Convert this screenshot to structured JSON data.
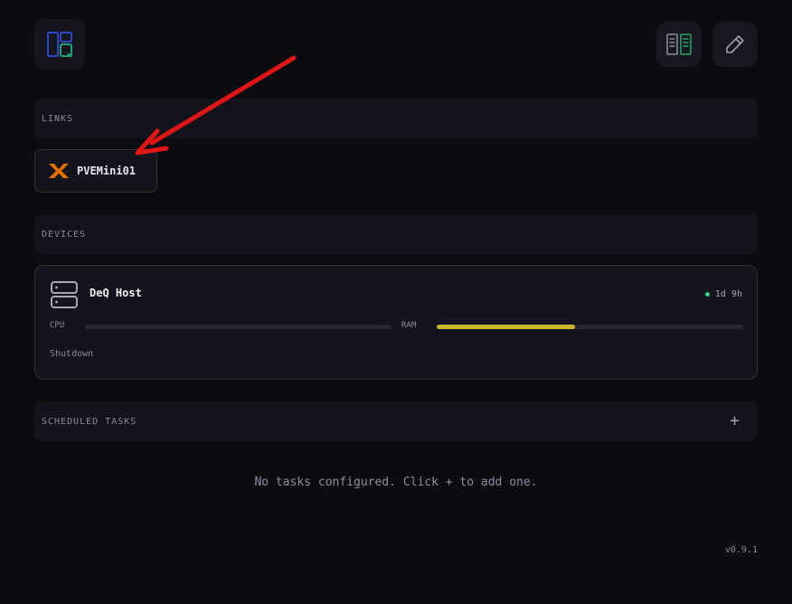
{
  "header": {
    "logo_icon": "deq-logo-icon",
    "layout_button_icon": "panels-icon",
    "edit_button_icon": "pencil-icon"
  },
  "links": {
    "title": "LINKS",
    "items": [
      {
        "label": "PVEMini01",
        "icon": "proxmox-icon",
        "icon_color": "#e57000"
      }
    ]
  },
  "devices": {
    "title": "DEVICES",
    "items": [
      {
        "name": "DeQ Host",
        "icon": "server-icon",
        "uptime": "1d 9h",
        "status_color": "#2fd67a",
        "cpu_label": "CPU",
        "cpu_fraction": 0.0,
        "ram_label": "RAM",
        "ram_fraction": 0.45,
        "ram_color": "#c9b92c",
        "shutdown_label": "Shutdown"
      }
    ]
  },
  "tasks": {
    "title": "SCHEDULED TASKS",
    "add_label": "+",
    "empty_message": "No tasks configured. Click + to add one."
  },
  "version": "v0.9.1",
  "annotation": {
    "type": "arrow",
    "color": "#e01616",
    "points_to": "link PVEMini01"
  }
}
